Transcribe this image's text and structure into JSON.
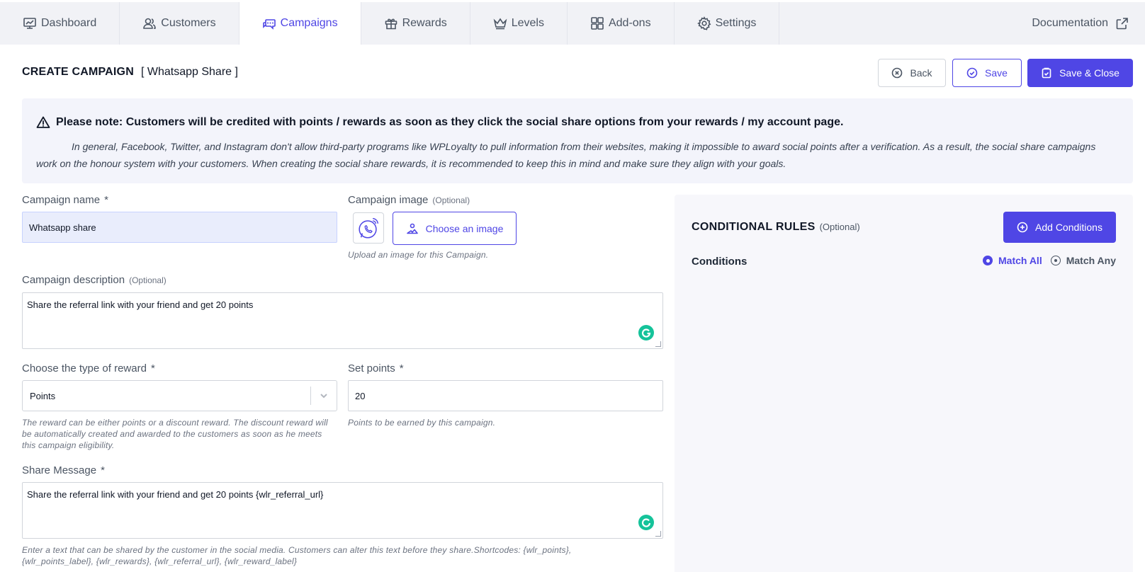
{
  "nav": {
    "tabs": [
      {
        "label": "Dashboard",
        "icon": "dashboard-icon"
      },
      {
        "label": "Customers",
        "icon": "users-icon"
      },
      {
        "label": "Campaigns",
        "icon": "chat-icon",
        "active": true
      },
      {
        "label": "Rewards",
        "icon": "gift-icon"
      },
      {
        "label": "Levels",
        "icon": "crown-icon"
      },
      {
        "label": "Add-ons",
        "icon": "grid-icon"
      },
      {
        "label": "Settings",
        "icon": "gear-icon"
      }
    ],
    "documentation": "Documentation"
  },
  "header": {
    "title": "CREATE CAMPAIGN",
    "subtitle": "[ Whatsapp Share ]",
    "back_label": "Back",
    "save_label": "Save",
    "save_close_label": "Save & Close"
  },
  "notice": {
    "heading": "Please note: Customers will be credited with points / rewards as soon as they click the social share options from your rewards / my account page.",
    "body": "In general, Facebook, Twitter, and Instagram don't allow third-party programs like WPLoyalty to pull information from their websites, making it impossible to award social points after a verification. As a result, the social share campaigns work on the honour system with your customers. When creating the social share rewards, it is recommended to keep this in mind and make sure they align with your goals."
  },
  "form": {
    "campaign_name": {
      "label": "Campaign name",
      "required": "*",
      "value": "Whatsapp share"
    },
    "campaign_image": {
      "label": "Campaign image",
      "optional": "(Optional)",
      "button": "Choose an image",
      "help": "Upload an image for this Campaign."
    },
    "campaign_description": {
      "label": "Campaign description",
      "optional": "(Optional)",
      "value": "Share the referral link with your friend and get 20 points"
    },
    "reward_type": {
      "label": "Choose the type of reward",
      "required": "*",
      "value": "Points",
      "help": "The reward can be either points or a discount reward. The discount reward will be automatically created and awarded to the customers as soon as he meets this campaign eligibility."
    },
    "set_points": {
      "label": "Set points",
      "required": "*",
      "value": "20",
      "help": "Points to be earned by this campaign."
    },
    "share_message": {
      "label": "Share Message",
      "required": "*",
      "value": "Share the referral link with your friend and get 20 points {wlr_referral_url}",
      "help": "Enter a text that can be shared by the customer in the social media. Customers can alter this text before they share.Shortcodes: {wlr_points}, {wlr_points_label}, {wlr_rewards}, {wlr_referral_url}, {wlr_reward_label}"
    }
  },
  "conditional_rules": {
    "title": "CONDITIONAL RULES",
    "optional": "(Optional)",
    "add_button": "Add Conditions",
    "conditions_label": "Conditions",
    "match_all": "Match All",
    "match_any": "Match Any",
    "selected": "Match All"
  },
  "colors": {
    "accent": "#4f46e5",
    "grammarly": "#15c39a",
    "nav_bg": "#f1f2f6",
    "panel_bg": "#f7f7fb"
  }
}
